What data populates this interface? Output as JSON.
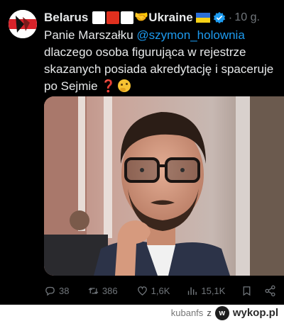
{
  "tweet": {
    "author_name": "Belarus",
    "author_suffix": "Ukraine",
    "time_sep": "·",
    "time": "10 g.",
    "text_line1": "Panie Marszałku ",
    "mention": "@szymon_holownia",
    "text_rest": "dlaczego osoba figurująca w rejestrze skazanych posiada akredytację i spaceruje po Sejmie ",
    "question_mark": "❓"
  },
  "actions": {
    "replies": "38",
    "reposts": "386",
    "likes": "1,6K",
    "views": "15,1K"
  },
  "footer": {
    "username": "kubanfs",
    "connector": "z",
    "logo_text": "wykop.pl",
    "logo_letter": "w"
  },
  "colors": {
    "background": "#000000",
    "text": "#e7e9ea",
    "muted": "#71767b",
    "link": "#1d9bf0",
    "verified": "#1d9bf0",
    "flag_red": "#e0301e"
  },
  "icons": [
    "avatar",
    "handshake-icon",
    "flag-icon",
    "verified-badge-icon",
    "question-icon",
    "thinking-face-icon",
    "reply-icon",
    "repost-icon",
    "like-icon",
    "views-icon",
    "bookmark-icon",
    "share-icon",
    "wykop-logo-icon"
  ]
}
